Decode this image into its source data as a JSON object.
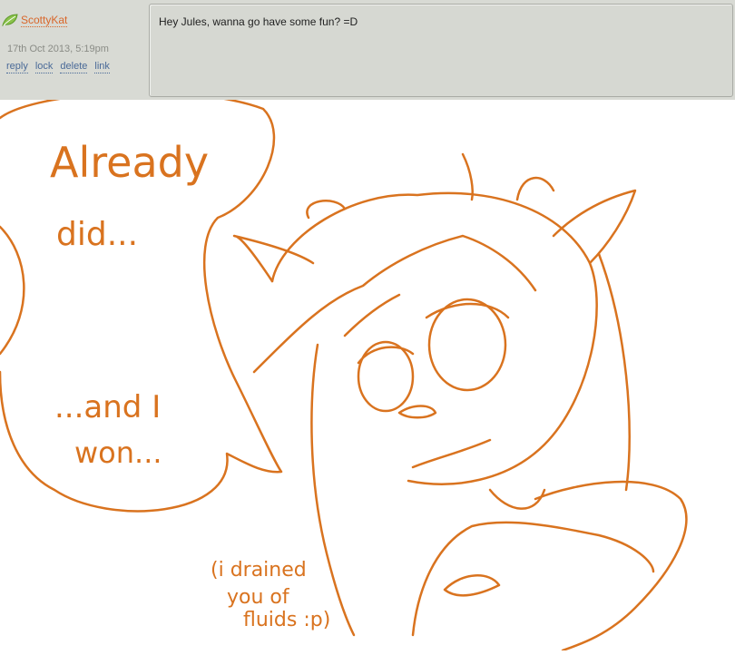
{
  "comment": {
    "username": "ScottyKat",
    "timestamp": "17th Oct 2013, 5:19pm",
    "actions": [
      "reply",
      "lock",
      "delete",
      "link"
    ],
    "text": "Hey Jules, wanna go have some fun? =D"
  },
  "artwork": {
    "bubble_line1": "Already",
    "bubble_line2": "did...",
    "bubble_line3": "...and I",
    "bubble_line4": "won...",
    "aside_line1": "(i drained",
    "aside_line2": "you of",
    "aside_line3": "fluids :p)"
  },
  "colors": {
    "line_art": "#d9731f",
    "username": "#d9662a",
    "link": "#4a6a98",
    "bar_bg": "#d8dad4"
  }
}
